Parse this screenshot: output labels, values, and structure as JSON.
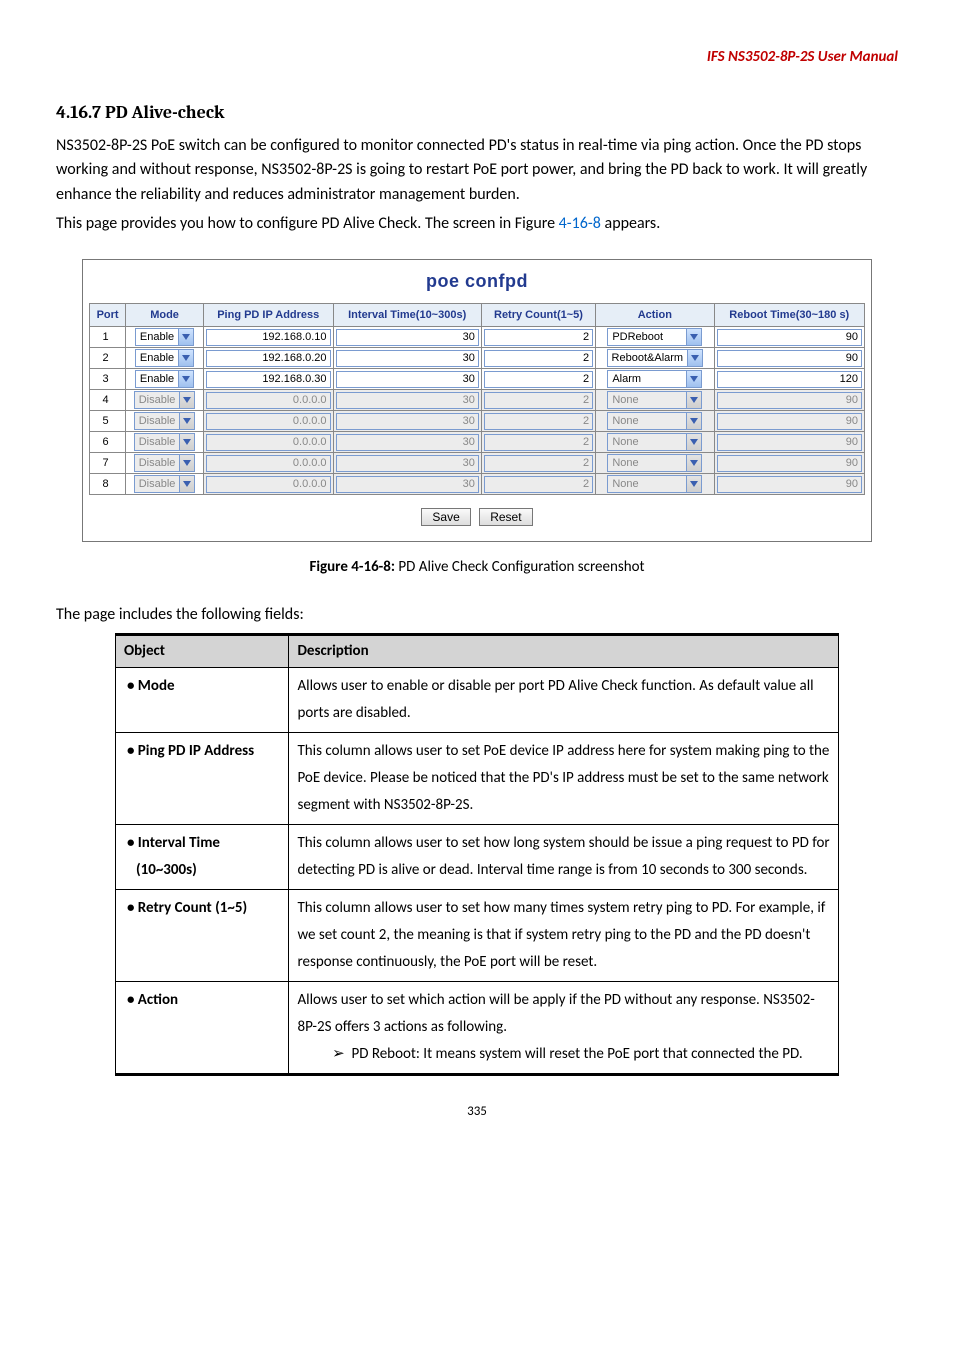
{
  "header": {
    "title": "IFS  NS3502-8P-2S  User Manual"
  },
  "section": {
    "heading": "4.16.7 PD Alive-check",
    "p1": "NS3502-8P-2S PoE switch can be configured to monitor connected PD's status in real-time via ping action. Once the PD stops working and without response, NS3502-8P-2S is going to restart PoE port power, and bring the PD back to work. It will greatly enhance the reliability and reduces administrator management burden.",
    "p2_a": "This page provides you how to configure PD Alive Check. The screen in Figure ",
    "fig_ref": "4-16-8",
    "p2_b": " appears."
  },
  "shot": {
    "title": "poe confpd",
    "cols": {
      "port": "Port",
      "mode": "Mode",
      "ip": "Ping PD IP Address",
      "interval": "Interval Time(10~300s)",
      "retry": "Retry Count(1~5)",
      "action": "Action",
      "reboot": "Reboot Time(30~180 s)"
    },
    "rows": [
      {
        "port": "1",
        "mode": "Enable",
        "ip": "192.168.0.10",
        "interval": "30",
        "retry": "2",
        "action": "PDReboot",
        "reboot": "90",
        "enabled": true
      },
      {
        "port": "2",
        "mode": "Enable",
        "ip": "192.168.0.20",
        "interval": "30",
        "retry": "2",
        "action": "Reboot&Alarm",
        "reboot": "90",
        "enabled": true
      },
      {
        "port": "3",
        "mode": "Enable",
        "ip": "192.168.0.30",
        "interval": "30",
        "retry": "2",
        "action": "Alarm",
        "reboot": "120",
        "enabled": true
      },
      {
        "port": "4",
        "mode": "Disable",
        "ip": "0.0.0.0",
        "interval": "30",
        "retry": "2",
        "action": "None",
        "reboot": "90",
        "enabled": false
      },
      {
        "port": "5",
        "mode": "Disable",
        "ip": "0.0.0.0",
        "interval": "30",
        "retry": "2",
        "action": "None",
        "reboot": "90",
        "enabled": false
      },
      {
        "port": "6",
        "mode": "Disable",
        "ip": "0.0.0.0",
        "interval": "30",
        "retry": "2",
        "action": "None",
        "reboot": "90",
        "enabled": false
      },
      {
        "port": "7",
        "mode": "Disable",
        "ip": "0.0.0.0",
        "interval": "30",
        "retry": "2",
        "action": "None",
        "reboot": "90",
        "enabled": false
      },
      {
        "port": "8",
        "mode": "Disable",
        "ip": "0.0.0.0",
        "interval": "30",
        "retry": "2",
        "action": "None",
        "reboot": "90",
        "enabled": false
      }
    ],
    "save": "Save",
    "reset": "Reset"
  },
  "figcap": {
    "label": "Figure 4-16-8:",
    "text": " PD Alive Check Configuration screenshot"
  },
  "intro2": "The page includes the following fields:",
  "desc": {
    "h_obj": "Object",
    "h_desc": "Description",
    "rows": [
      {
        "obj": "•  Mode",
        "desc": "Allows user to enable or disable per port PD Alive Check function. As default value all ports are disabled."
      },
      {
        "obj": "•  Ping PD IP Address",
        "desc": "This column allows user to set PoE device IP address here for system making ping to the PoE device. Please be noticed that the PD's IP address must be set to the same network segment with NS3502-8P-2S."
      },
      {
        "obj": "•  Interval Time (10~300s)",
        "desc": "This column allows user to set how long system should be issue a ping request to PD for detecting PD is alive or dead. Interval time range is from 10 seconds to 300 seconds."
      },
      {
        "obj": "•  Retry Count (1~5)",
        "desc": "This column allows user to set how many times system retry ping to PD. For example, if we set count 2, the meaning is that if system retry ping to the PD and the PD doesn't response continuously, the PoE port will be reset."
      },
      {
        "obj": "•  Action",
        "desc": "Allows user to set which action will be apply if the PD without any response. NS3502-8P-2S offers 3 actions as following.",
        "sub": "PD Reboot: It means system will reset the PoE port that connected the PD."
      }
    ]
  },
  "pageno": "335"
}
